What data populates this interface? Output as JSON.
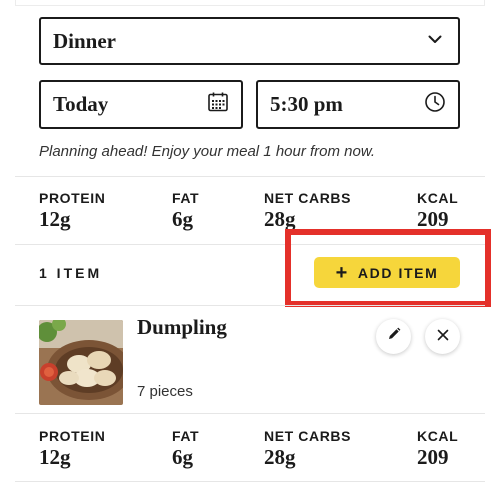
{
  "meal_select": {
    "value": "Dinner",
    "icon": "chevron-down-icon"
  },
  "date_field": {
    "value": "Today",
    "icon": "calendar-icon"
  },
  "time_field": {
    "value": "5:30 pm",
    "icon": "clock-icon"
  },
  "note": "Planning ahead! Enjoy your meal 1 hour from now.",
  "summary_macros": [
    {
      "label": "PROTEIN",
      "value": "12g"
    },
    {
      "label": "FAT",
      "value": "6g"
    },
    {
      "label": "NET CARBS",
      "value": "28g"
    },
    {
      "label": "KCAL",
      "value": "209"
    }
  ],
  "items_header": {
    "count_label": "1 ITEM",
    "add_button_label": "ADD ITEM",
    "add_icon": "plus-icon"
  },
  "items": [
    {
      "name": "Dumpling",
      "quantity": "7 pieces",
      "edit_icon": "pencil-icon",
      "remove_icon": "close-icon"
    }
  ],
  "footer_macros": [
    {
      "label": "PROTEIN",
      "value": "12g"
    },
    {
      "label": "FAT",
      "value": "6g"
    },
    {
      "label": "NET CARBS",
      "value": "28g"
    },
    {
      "label": "KCAL",
      "value": "209"
    }
  ],
  "colors": {
    "accent_yellow": "#f6d63b",
    "highlight_red": "#e4302a",
    "text": "#1b1b1b",
    "divider": "#e6e6e6"
  }
}
